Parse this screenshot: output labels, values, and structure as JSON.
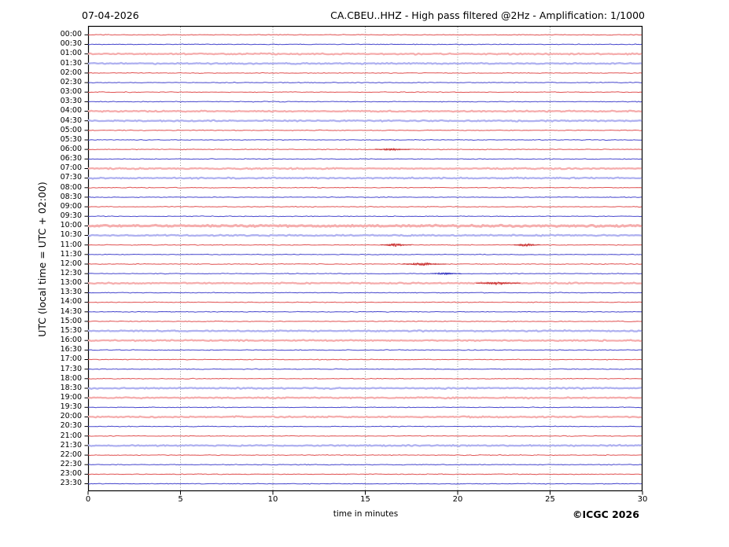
{
  "header": {
    "date": "07-04-2026",
    "title": "CA.CBEU..HHZ - High pass filtered @2Hz - Amplification: 1/1000"
  },
  "axes": {
    "y_label": "UTC (local time = UTC + 02:00)",
    "x_label": "time in minutes"
  },
  "footer": {
    "copyright": "©ICGC 2026"
  },
  "chart_data": {
    "type": "line",
    "subtype": "helicorder-day-plot",
    "station": "CA.CBEU..HHZ",
    "filter": "High pass filtered @2Hz",
    "amplification": "1/1000",
    "date": "07-04-2026",
    "x_range": [
      0,
      30
    ],
    "x_ticks": [
      0,
      5,
      10,
      15,
      20,
      25,
      30
    ],
    "grid_minutes": [
      5,
      10,
      15,
      20,
      25
    ],
    "row_interval_minutes": 30,
    "colors": {
      "red": "#e05252",
      "red_light": "#f5adad",
      "blue": "#4747cd",
      "blue_light": "#afb1f0",
      "red_event": "#c93030",
      "blue_event": "#3232c0",
      "grid": "#909090",
      "axis": "#000000"
    },
    "rows": [
      {
        "time": "00:00",
        "color": "red",
        "light": false,
        "events": []
      },
      {
        "time": "00:30",
        "color": "blue",
        "light": false,
        "events": []
      },
      {
        "time": "01:00",
        "color": "red",
        "light": true,
        "events": []
      },
      {
        "time": "01:30",
        "color": "blue",
        "light": true,
        "events": []
      },
      {
        "time": "02:00",
        "color": "red",
        "light": false,
        "events": []
      },
      {
        "time": "02:30",
        "color": "blue",
        "light": false,
        "events": []
      },
      {
        "time": "03:00",
        "color": "red",
        "light": false,
        "events": []
      },
      {
        "time": "03:30",
        "color": "blue",
        "light": false,
        "events": []
      },
      {
        "time": "04:00",
        "color": "red",
        "light": true,
        "events": []
      },
      {
        "time": "04:30",
        "color": "blue",
        "light": true,
        "events": []
      },
      {
        "time": "05:00",
        "color": "red",
        "light": false,
        "events": []
      },
      {
        "time": "05:30",
        "color": "blue",
        "light": false,
        "events": []
      },
      {
        "time": "06:00",
        "color": "red",
        "light": false,
        "events": [
          {
            "minute": 16.4,
            "amp": 1.1,
            "width": 0.4
          }
        ]
      },
      {
        "time": "06:30",
        "color": "blue",
        "light": false,
        "events": []
      },
      {
        "time": "07:00",
        "color": "red",
        "light": true,
        "events": []
      },
      {
        "time": "07:30",
        "color": "blue",
        "light": true,
        "events": []
      },
      {
        "time": "08:00",
        "color": "red",
        "light": false,
        "events": []
      },
      {
        "time": "08:30",
        "color": "blue",
        "light": false,
        "events": []
      },
      {
        "time": "09:00",
        "color": "red",
        "light": false,
        "events": []
      },
      {
        "time": "09:30",
        "color": "blue",
        "light": false,
        "events": []
      },
      {
        "time": "10:00",
        "color": "red",
        "light": true,
        "sw": 3.0,
        "amp": 0.8,
        "events": []
      },
      {
        "time": "10:30",
        "color": "blue",
        "light": true,
        "events": []
      },
      {
        "time": "11:00",
        "color": "red",
        "light": false,
        "events": [
          {
            "minute": 16.6,
            "amp": 2.0,
            "width": 0.35
          },
          {
            "minute": 23.7,
            "amp": 1.7,
            "width": 0.3
          }
        ]
      },
      {
        "time": "11:30",
        "color": "blue",
        "light": false,
        "events": []
      },
      {
        "time": "12:00",
        "color": "red",
        "light": false,
        "events": [
          {
            "minute": 18.1,
            "amp": 1.6,
            "width": 0.5
          }
        ]
      },
      {
        "time": "12:30",
        "color": "blue",
        "light": false,
        "events": [
          {
            "minute": 19.3,
            "amp": 1.0,
            "width": 0.35
          }
        ]
      },
      {
        "time": "13:00",
        "color": "red",
        "light": true,
        "events": [
          {
            "minute": 22.1,
            "amp": 1.5,
            "width": 0.5
          }
        ]
      },
      {
        "time": "13:30",
        "color": "blue",
        "light": false,
        "events": []
      },
      {
        "time": "14:00",
        "color": "red",
        "light": false,
        "events": []
      },
      {
        "time": "14:30",
        "color": "blue",
        "light": false,
        "events": []
      },
      {
        "time": "15:00",
        "color": "red",
        "light": false,
        "events": []
      },
      {
        "time": "15:30",
        "color": "blue",
        "light": true,
        "events": []
      },
      {
        "time": "16:00",
        "color": "red",
        "light": true,
        "events": []
      },
      {
        "time": "16:30",
        "color": "blue",
        "light": false,
        "events": []
      },
      {
        "time": "17:00",
        "color": "red",
        "light": false,
        "events": []
      },
      {
        "time": "17:30",
        "color": "blue",
        "light": false,
        "events": []
      },
      {
        "time": "18:00",
        "color": "red",
        "light": false,
        "events": []
      },
      {
        "time": "18:30",
        "color": "blue",
        "light": true,
        "events": []
      },
      {
        "time": "19:00",
        "color": "red",
        "light": true,
        "events": []
      },
      {
        "time": "19:30",
        "color": "blue",
        "light": false,
        "events": []
      },
      {
        "time": "20:00",
        "color": "red",
        "light": true,
        "events": []
      },
      {
        "time": "20:30",
        "color": "blue",
        "light": false,
        "events": []
      },
      {
        "time": "21:00",
        "color": "red",
        "light": false,
        "events": []
      },
      {
        "time": "21:30",
        "color": "blue",
        "light": true,
        "events": []
      },
      {
        "time": "22:00",
        "color": "red",
        "light": false,
        "events": []
      },
      {
        "time": "22:30",
        "color": "blue",
        "light": false,
        "events": []
      },
      {
        "time": "23:00",
        "color": "red",
        "light": false,
        "events": []
      },
      {
        "time": "23:30",
        "color": "blue",
        "light": false,
        "events": []
      }
    ]
  }
}
